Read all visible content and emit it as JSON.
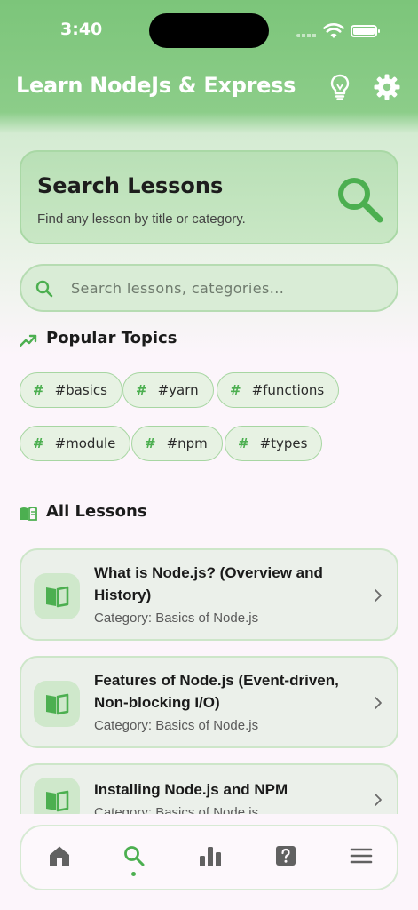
{
  "status_bar": {
    "time": "3:40"
  },
  "app_bar": {
    "title": "Learn NodeJs & Express"
  },
  "search_card": {
    "title": "Search Lessons",
    "subtitle": "Find any lesson by title or category."
  },
  "search": {
    "placeholder": "Search lessons, categories...",
    "value": ""
  },
  "popular_topics": {
    "title": "Popular Topics",
    "chips": [
      {
        "label": "#basics"
      },
      {
        "label": "#yarn"
      },
      {
        "label": "#functions"
      },
      {
        "label": "#module"
      },
      {
        "label": "#npm"
      },
      {
        "label": "#types"
      }
    ]
  },
  "all_lessons": {
    "title": "All Lessons",
    "items": [
      {
        "title": "What is Node.js? (Overview and History)",
        "category": "Category: Basics of Node.js"
      },
      {
        "title": "Features of Node.js (Event-driven, Non-blocking I/O)",
        "category": "Category: Basics of Node.js"
      },
      {
        "title": "Installing Node.js and NPM",
        "category": "Category: Basics of Node.js"
      }
    ]
  },
  "bottom_nav": {
    "items": [
      {
        "icon": "home-icon",
        "active": false
      },
      {
        "icon": "search-icon",
        "active": true
      },
      {
        "icon": "bar-chart-icon",
        "active": false
      },
      {
        "icon": "help-icon",
        "active": false
      },
      {
        "icon": "menu-icon",
        "active": false
      }
    ]
  },
  "colors": {
    "accent": "#4caf50",
    "header": "#7cc57a",
    "background": "#fcf5fb"
  }
}
